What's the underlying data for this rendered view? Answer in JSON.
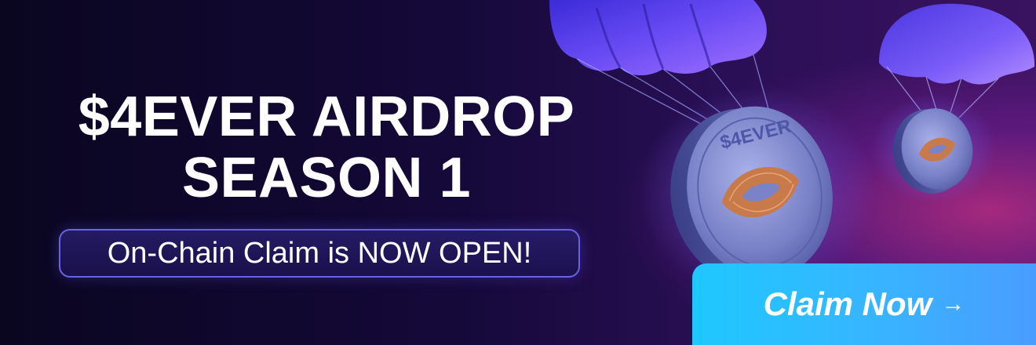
{
  "banner": {
    "headline_line1": "$4EVER AIRDROP",
    "headline_line2": "SEASON 1",
    "status_text": "On-Chain Claim is NOW OPEN!",
    "cta_label": "Claim Now",
    "cta_arrow": "→",
    "coin_text": "$4EVER"
  },
  "colors": {
    "background": "#0c0824",
    "accent_pink": "#ff3c96",
    "pill_border": "#6a62e6",
    "cta_start": "#1ec8ff",
    "cta_end": "#4a9cff",
    "parachute": "#5a3cf0",
    "coin": "#8a92d6",
    "coin_emblem": "#c87a4a"
  },
  "icons": [
    "parachute-icon",
    "coin-icon",
    "arrow-right-icon"
  ]
}
